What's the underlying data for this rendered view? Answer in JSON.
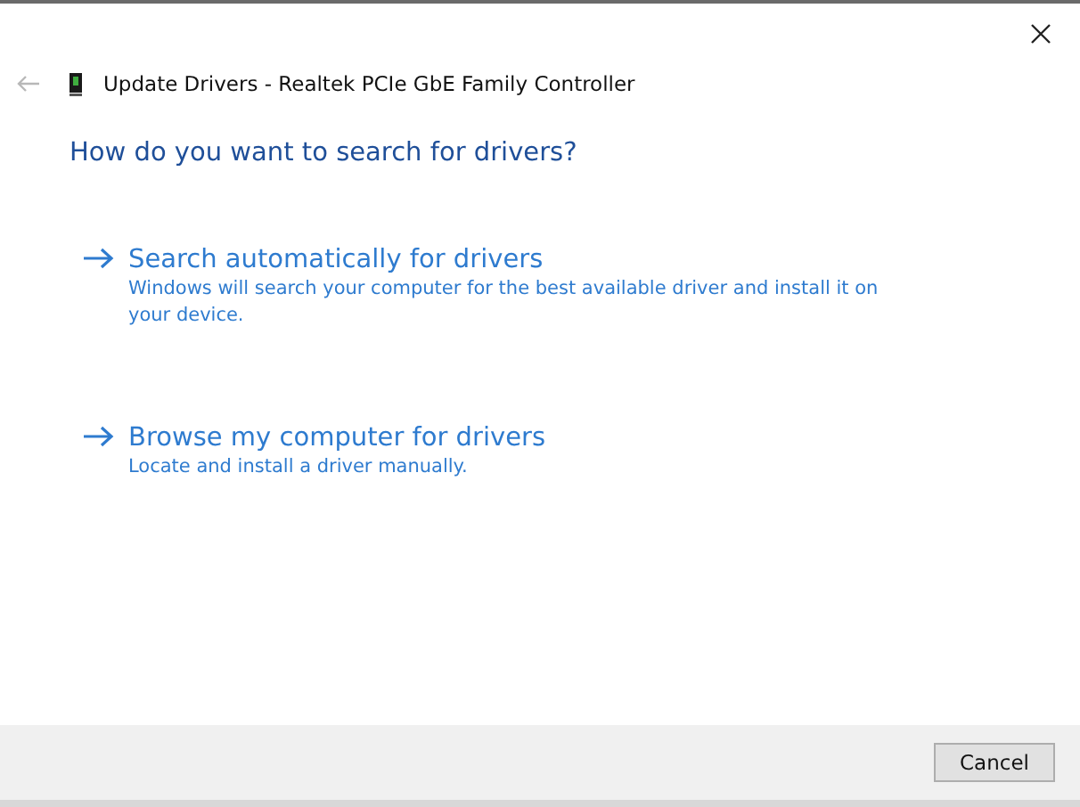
{
  "back_button": {
    "disabled": true
  },
  "window": {
    "title": "Update Drivers - Realtek PCIe GbE Family Controller"
  },
  "heading": "How do you want to search for drivers?",
  "options": [
    {
      "title": "Search automatically for drivers",
      "description": "Windows will search your computer for the best available driver and install it on your device."
    },
    {
      "title": "Browse my computer for drivers",
      "description": "Locate and install a driver manually."
    }
  ],
  "buttons": [
    "Cancel"
  ]
}
